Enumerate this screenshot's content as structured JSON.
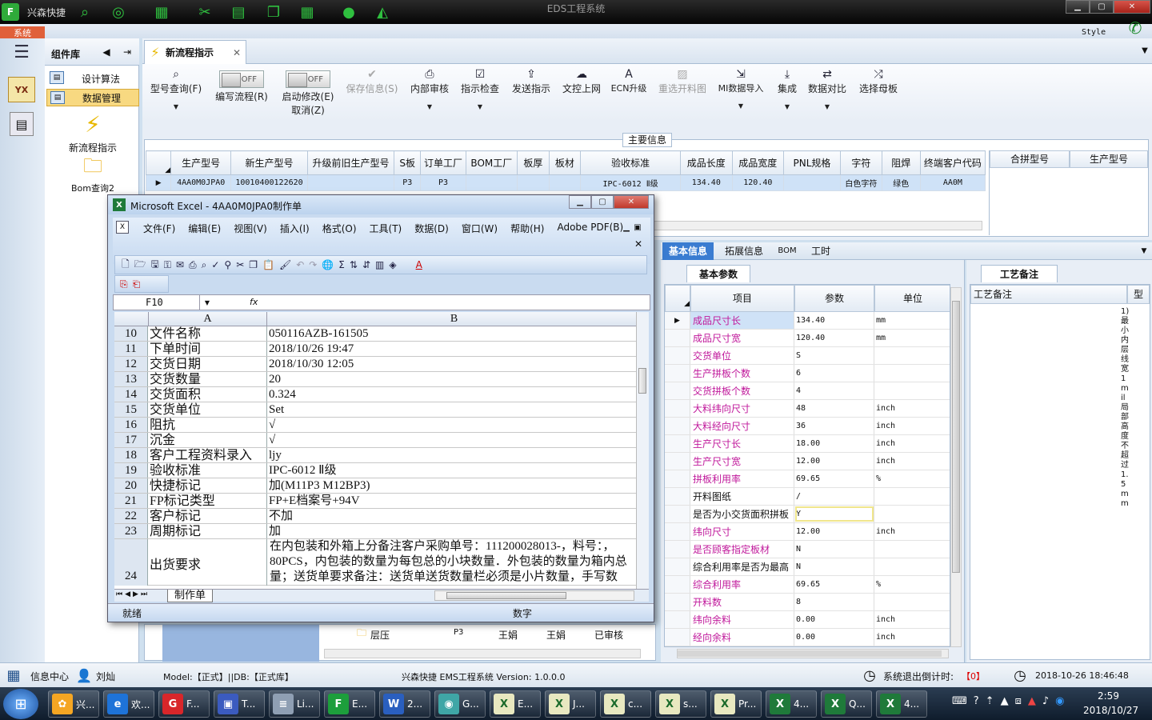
{
  "window": {
    "app_name": "兴森快捷",
    "title": "EDS工程系统",
    "style_label": "Style"
  },
  "system_tab": "系统",
  "component_panel": {
    "title": "组件库",
    "items": [
      "设计算法",
      "数据管理"
    ],
    "launch_items": [
      "新流程指示",
      "Bom查询2"
    ]
  },
  "tab": {
    "label": "新流程指示"
  },
  "toolbar": {
    "buttons": [
      {
        "label": "型号查询(F)",
        "icon": "search-icon"
      },
      {
        "label": "编写流程(R)",
        "toggle": "OFF"
      },
      {
        "label": "启动修改(E)",
        "toggle": "OFF",
        "sub": "取消(Z)"
      },
      {
        "label": "保存信息(S)",
        "disabled": true,
        "icon": "check-icon"
      },
      {
        "label": "内部审核",
        "icon": "printer-icon"
      },
      {
        "label": "指示检查",
        "icon": "checkbox-icon"
      },
      {
        "label": "发送指示",
        "icon": "upload-icon"
      },
      {
        "label": "文控上网",
        "icon": "cloud-icon"
      },
      {
        "label": "ECN升级",
        "icon": "font-a-icon"
      },
      {
        "label": "重选开料图",
        "disabled": true,
        "icon": "image-icon"
      },
      {
        "label": "MI数据导入",
        "icon": "import-icon"
      },
      {
        "label": "集成",
        "icon": "download-icon"
      },
      {
        "label": "数据对比",
        "icon": "compare-icon"
      },
      {
        "label": "选择母板",
        "icon": "shuffle-icon"
      }
    ]
  },
  "main_info": {
    "legend": "主要信息",
    "columns": [
      "生产型号",
      "新生产型号",
      "升级前旧生产型号",
      "S板",
      "订单工厂",
      "BOM工厂",
      "板厚",
      "板材",
      "验收标准",
      "成品长度",
      "成品宽度",
      "PNL规格",
      "字符",
      "阻焊",
      "终端客户代码"
    ],
    "row": [
      "4AA0M0JPA0",
      "10010400122620",
      "",
      "P3",
      "P3",
      "",
      "",
      "",
      "IPC-6012 Ⅱ级",
      "134.40",
      "120.40",
      "",
      "白色字符",
      "绿色",
      "AA0M"
    ],
    "side_columns": [
      "合拼型号",
      "生产型号"
    ]
  },
  "detail_tabs": [
    "基本信息",
    "拓展信息",
    "BOM",
    "工时"
  ],
  "basic_params": {
    "tab": "基本参数",
    "columns": [
      "项目",
      "参数",
      "单位"
    ],
    "rows": [
      {
        "k": "成品尺寸长",
        "v": "134.40",
        "u": "mm",
        "hl": true
      },
      {
        "k": "成品尺寸宽",
        "v": "120.40",
        "u": "mm",
        "hl": true
      },
      {
        "k": "交货单位",
        "v": "S",
        "u": "",
        "hl": true
      },
      {
        "k": "生产拼板个数",
        "v": "6",
        "u": "",
        "hl": true
      },
      {
        "k": "交货拼板个数",
        "v": "4",
        "u": "",
        "hl": true
      },
      {
        "k": "大料纬向尺寸",
        "v": "48",
        "u": "inch",
        "hl": true
      },
      {
        "k": "大料经向尺寸",
        "v": "36",
        "u": "inch",
        "hl": true
      },
      {
        "k": "生产尺寸长",
        "v": "18.00",
        "u": "inch",
        "hl": true
      },
      {
        "k": "生产尺寸宽",
        "v": "12.00",
        "u": "inch",
        "hl": true
      },
      {
        "k": "拼板利用率",
        "v": "69.65",
        "u": "%",
        "hl": true
      },
      {
        "k": "开料图纸",
        "v": "/",
        "u": "",
        "hl": false
      },
      {
        "k": "是否为小交货面积拼板",
        "v": "Y",
        "u": "",
        "hl": false
      },
      {
        "k": "纬向尺寸",
        "v": "12.00",
        "u": "inch",
        "hl": true
      },
      {
        "k": "是否顾客指定板材",
        "v": "N",
        "u": "",
        "hl": true
      },
      {
        "k": "综合利用率是否为最高",
        "v": "N",
        "u": "",
        "hl": false
      },
      {
        "k": "综合利用率",
        "v": "69.65",
        "u": "%",
        "hl": true
      },
      {
        "k": "开料数",
        "v": "8",
        "u": "",
        "hl": true
      },
      {
        "k": "纬向余料",
        "v": "0.00",
        "u": "inch",
        "hl": true
      },
      {
        "k": "经向余料",
        "v": "0.00",
        "u": "inch",
        "hl": true
      }
    ]
  },
  "process_notes": {
    "tab": "工艺备注",
    "header": "工艺备注",
    "col2": "型",
    "vertical_text": "1)最小内层线宽1mil局部高度不超过1.5mm"
  },
  "lower_grid": {
    "row": [
      "层压",
      "P3",
      "王娟",
      "王娟",
      "已审核"
    ]
  },
  "excel": {
    "title": "Microsoft Excel - 4AA0M0JPA0制作单",
    "menu": [
      "文件(F)",
      "编辑(E)",
      "视图(V)",
      "插入(I)",
      "格式(O)",
      "工具(T)",
      "数据(D)",
      "窗口(W)",
      "帮助(H)",
      "Adobe PDF(B)"
    ],
    "cell_ref": "F10",
    "fx": "fx",
    "col_a": "A",
    "col_b": "B",
    "rows": [
      {
        "n": "10",
        "a": "文件名称",
        "b": "050116AZB-161505"
      },
      {
        "n": "11",
        "a": "下单时间",
        "b": "2018/10/26 19:47"
      },
      {
        "n": "12",
        "a": "交货日期",
        "b": "2018/10/30 12:05"
      },
      {
        "n": "13",
        "a": "交货数量",
        "b": "20"
      },
      {
        "n": "14",
        "a": "交货面积",
        "b": "0.324"
      },
      {
        "n": "15",
        "a": "交货单位",
        "b": "Set"
      },
      {
        "n": "16",
        "a": "阻抗",
        "b": "√"
      },
      {
        "n": "17",
        "a": "沉金",
        "b": "√"
      },
      {
        "n": "18",
        "a": "客户工程资料录入",
        "b": "ljy"
      },
      {
        "n": "19",
        "a": "验收标准",
        "b": "IPC-6012 Ⅱ级"
      },
      {
        "n": "20",
        "a": "快捷标记",
        "b": "加(M11P3 M12BP3)"
      },
      {
        "n": "21",
        "a": "FP标记类型",
        "b": "FP+E档案号+94V"
      },
      {
        "n": "22",
        "a": "客户标记",
        "b": "不加"
      },
      {
        "n": "23",
        "a": "周期标记",
        "b": "加"
      }
    ],
    "row24": {
      "n": "24",
      "a": "出货要求",
      "b_lines": [
        "在内包装和外箱上分备注客户采购单号：111200028013-，料号：，",
        "80PCS，内包装的数量为每包总的小块数量．外包装的数量为箱内总",
        "量；送货单要求备注：送货单送货数量栏必须是小片数量，手写数"
      ]
    },
    "sheet_tab": "制作单",
    "status_ready": "就绪",
    "status_num": "数字"
  },
  "statusbar": {
    "info_center": "信息中心",
    "user": "刘灿",
    "model": "Model:【正式】||DB:【正式库】",
    "version": "兴森快捷 EMS工程系统 Version: 1.0.0.0",
    "countdown_label": "系统退出倒计时:",
    "countdown_value": "【0】",
    "datetime": "2018-10-26 18:46:48"
  },
  "taskbar": {
    "tasks": [
      {
        "label": "兴...",
        "color": "#f5a623",
        "glyph": "✿"
      },
      {
        "label": "欢...",
        "color": "#1e73d8",
        "glyph": "e"
      },
      {
        "label": "F...",
        "color": "#d8262a",
        "glyph": "G"
      },
      {
        "label": "T...",
        "color": "#3b5bbf",
        "glyph": "▣"
      },
      {
        "label": "Li...",
        "color": "#8f9fb3",
        "glyph": "≡"
      },
      {
        "label": "E...",
        "color": "#1d9e3c",
        "glyph": "F"
      },
      {
        "label": "2...",
        "color": "#2a5fbf",
        "glyph": "W"
      },
      {
        "label": "G...",
        "color": "#3fa6a6",
        "glyph": "◉"
      },
      {
        "label": "E...",
        "color": "#e8e8c0",
        "glyph": "X"
      },
      {
        "label": "J...",
        "color": "#e8e8c0",
        "glyph": "X"
      },
      {
        "label": "c...",
        "color": "#e8e8c0",
        "glyph": "X"
      },
      {
        "label": "s...",
        "color": "#e8e8c0",
        "glyph": "X"
      },
      {
        "label": "Pr...",
        "color": "#e8e8c0",
        "glyph": "X"
      },
      {
        "label": "4...",
        "color": "#1f7a3a",
        "glyph": "X"
      },
      {
        "label": "Q...",
        "color": "#1f7a3a",
        "glyph": "X"
      },
      {
        "label": "4...",
        "color": "#1f7a3a",
        "glyph": "X"
      }
    ],
    "time": "2:59",
    "date": "2018/10/27"
  }
}
